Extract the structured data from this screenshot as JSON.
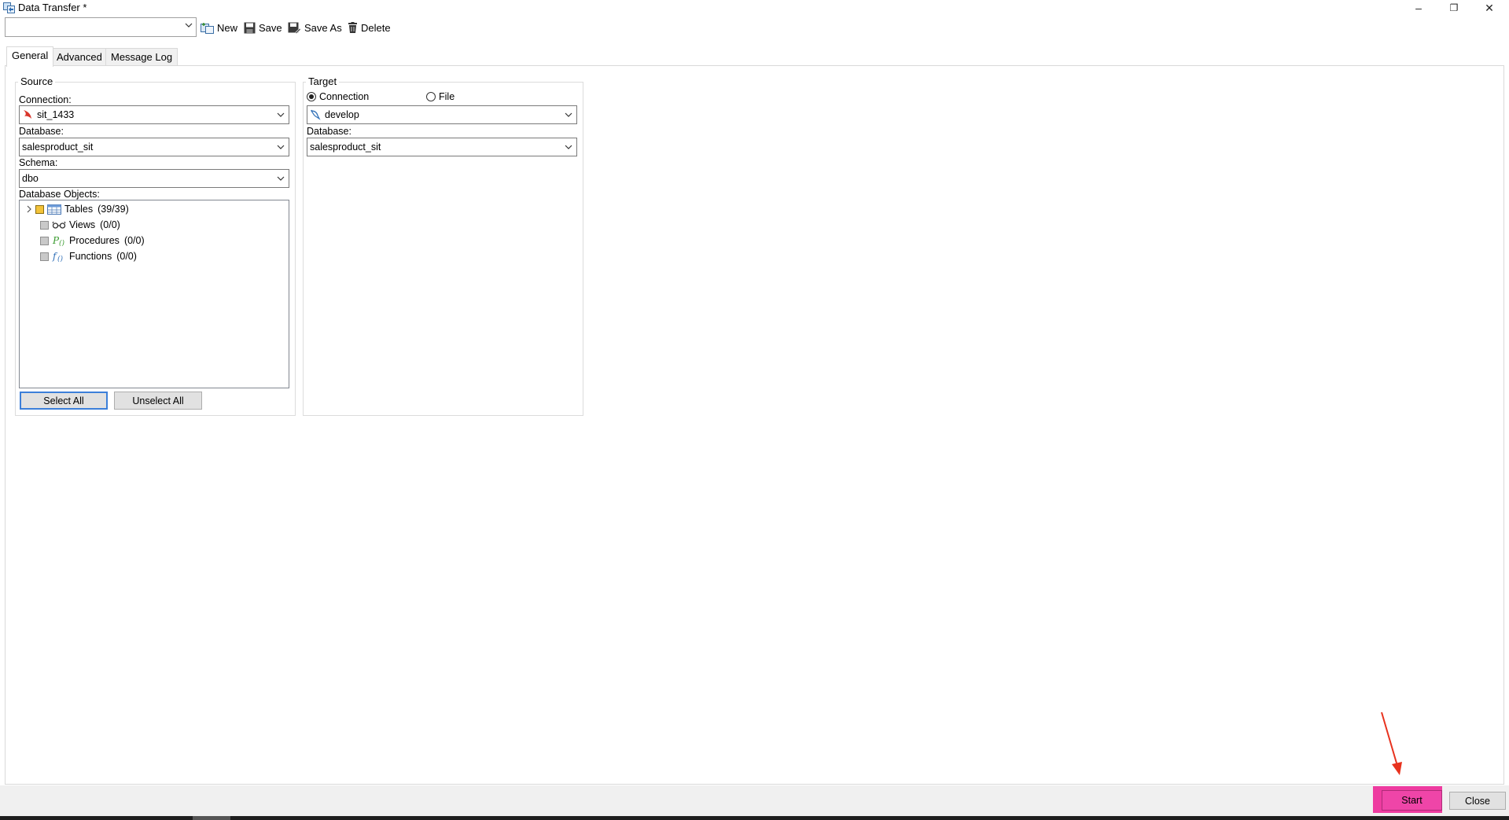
{
  "window": {
    "title": "Data Transfer *",
    "minimize": "–",
    "restore": "❐",
    "close": "✕"
  },
  "toolbar": {
    "profile_value": "",
    "new_label": "New",
    "save_label": "Save",
    "save_as_label": "Save As",
    "delete_label": "Delete"
  },
  "tabs": [
    {
      "label": "General",
      "active": true
    },
    {
      "label": "Advanced",
      "active": false
    },
    {
      "label": "Message Log",
      "active": false
    }
  ],
  "source": {
    "group_title": "Source",
    "connection_label": "Connection:",
    "connection_value": "sit_1433",
    "database_label": "Database:",
    "database_value": "salesproduct_sit",
    "schema_label": "Schema:",
    "schema_value": "dbo",
    "objects_label": "Database Objects:",
    "tree": [
      {
        "name": "Tables",
        "count": "(39/39)",
        "icon": "table-icon"
      },
      {
        "name": "Views",
        "count": "(0/0)",
        "icon": "view-glasses-icon"
      },
      {
        "name": "Procedures",
        "count": "(0/0)",
        "icon": "procedure-icon"
      },
      {
        "name": "Functions",
        "count": "(0/0)",
        "icon": "function-icon"
      }
    ],
    "select_all_label": "Select All",
    "unselect_all_label": "Unselect All"
  },
  "target": {
    "group_title": "Target",
    "radio_connection_label": "Connection",
    "radio_file_label": "File",
    "selected": "Connection",
    "connection_value": "develop",
    "database_label": "Database:",
    "database_value": "salesproduct_sit"
  },
  "footer": {
    "start_label": "Start",
    "close_label": "Close"
  },
  "colors": {
    "highlight": "#ee3ba0",
    "arrow": "#e8321e",
    "default_button_border": "#3c7fd9"
  }
}
